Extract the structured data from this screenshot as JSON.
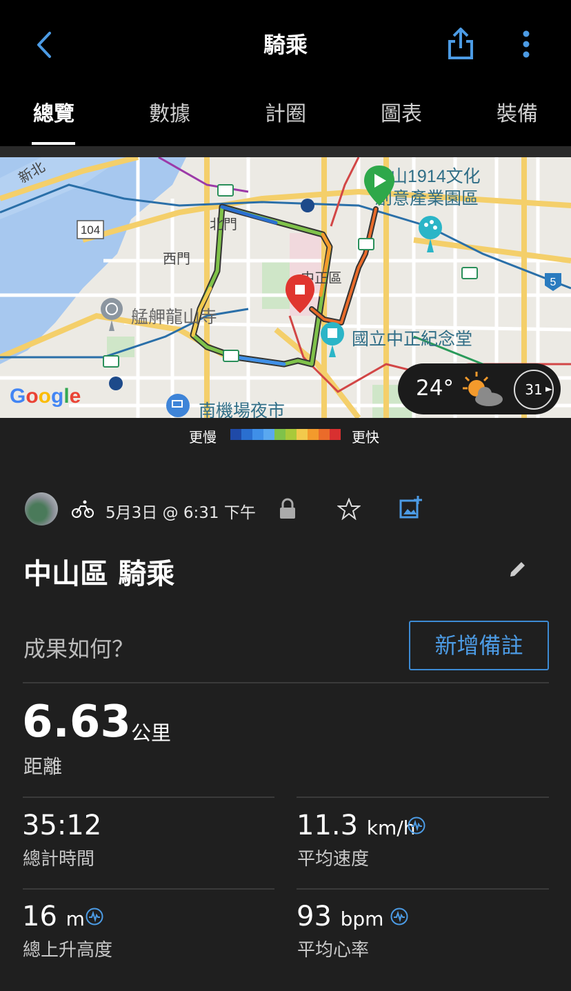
{
  "header": {
    "title": "騎乘"
  },
  "tabs": [
    {
      "label": "總覽",
      "active": true
    },
    {
      "label": "數據"
    },
    {
      "label": "計圈"
    },
    {
      "label": "圖表"
    },
    {
      "label": "裝備"
    }
  ],
  "map": {
    "labels": {
      "xinbei": "新北",
      "road104": "104",
      "beimen": "北門",
      "ximen": "西門",
      "zhongzheng": "中正區",
      "huashan": "華山1914文化創意產業園區",
      "huashan_l1": "山1914文化",
      "huashan_l2": "創意產業園區",
      "longshan": "艋舺龍山寺",
      "cks": "國立中正紀念堂",
      "nanjichang": "南機場夜市",
      "road5": "5",
      "google": "Google"
    }
  },
  "weather": {
    "temperature": "24°",
    "moon_day": "31"
  },
  "speed_legend": {
    "slow": "更慢",
    "fast": "更快",
    "colors": [
      "#1f4aa8",
      "#2a6fd0",
      "#3f8fe8",
      "#5aa8f0",
      "#7fc24a",
      "#a9c93a",
      "#f2c94c",
      "#f39a2c",
      "#ea6b2a",
      "#d83030"
    ]
  },
  "activity": {
    "date_time": "5月3日 @ 6:31 下午",
    "name": "中山區 騎乘",
    "notes_prompt": "成果如何？",
    "add_note_label": "新增備註"
  },
  "stats": {
    "distance": {
      "value": "6.63",
      "unit": "公里",
      "label": "距離"
    },
    "total_time": {
      "value": "35:12",
      "label": "總計時間"
    },
    "avg_speed": {
      "value": "11.3",
      "unit": "km/h",
      "label": "平均速度"
    },
    "elevation_gain": {
      "value": "16",
      "unit": "m",
      "label": "總上升高度"
    },
    "avg_heart_rate": {
      "value": "93",
      "unit": "bpm",
      "label": "平均心率"
    }
  },
  "colors": {
    "accent": "#3d8bd4",
    "start": "#2ea84a",
    "end": "#e0352f"
  }
}
